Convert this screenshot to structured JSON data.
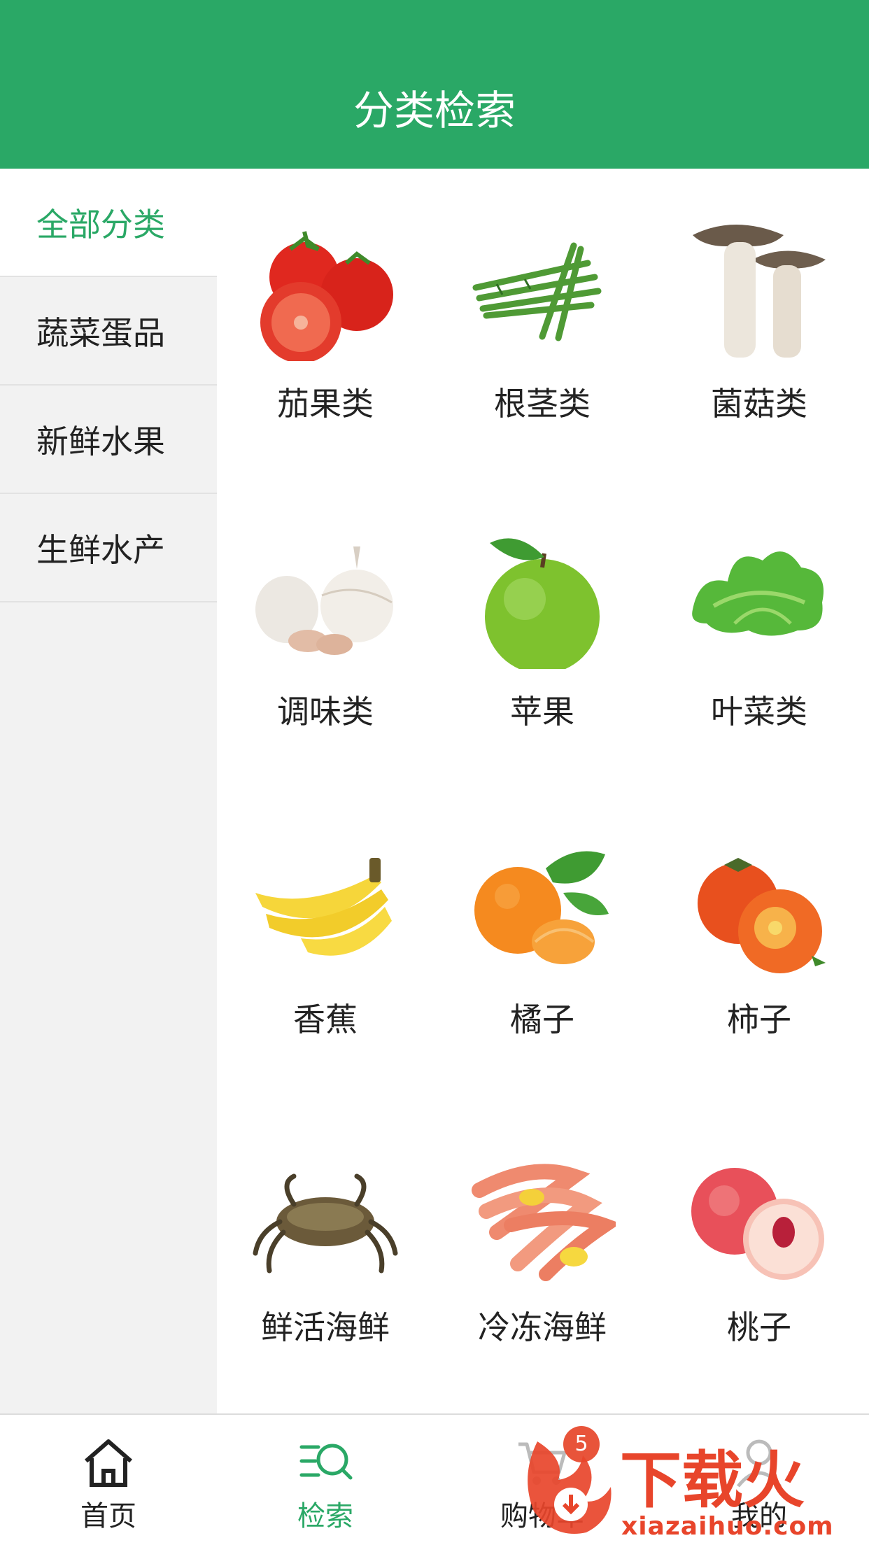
{
  "header": {
    "title": "分类检索"
  },
  "sidebar": {
    "items": [
      {
        "label": "全部分类",
        "active": true
      },
      {
        "label": "蔬菜蛋品",
        "active": false
      },
      {
        "label": "新鲜水果",
        "active": false
      },
      {
        "label": "生鲜水产",
        "active": false
      }
    ]
  },
  "grid": {
    "items": [
      {
        "label": "茄果类",
        "icon": "tomato-icon"
      },
      {
        "label": "根茎类",
        "icon": "asparagus-icon"
      },
      {
        "label": "菌菇类",
        "icon": "mushroom-icon"
      },
      {
        "label": "调味类",
        "icon": "garlic-icon"
      },
      {
        "label": "苹果",
        "icon": "apple-icon"
      },
      {
        "label": "叶菜类",
        "icon": "lettuce-icon"
      },
      {
        "label": "香蕉",
        "icon": "banana-icon"
      },
      {
        "label": "橘子",
        "icon": "orange-icon"
      },
      {
        "label": "柿子",
        "icon": "persimmon-icon"
      },
      {
        "label": "鲜活海鲜",
        "icon": "crab-icon"
      },
      {
        "label": "冷冻海鲜",
        "icon": "shrimp-icon"
      },
      {
        "label": "桃子",
        "icon": "peach-icon"
      }
    ]
  },
  "tabbar": {
    "tabs": [
      {
        "label": "首页",
        "icon": "home-icon"
      },
      {
        "label": "检索",
        "icon": "search-list-icon",
        "active": true
      },
      {
        "label": "购物车",
        "icon": "cart-icon",
        "badge": "5"
      },
      {
        "label": "我的",
        "icon": "user-icon"
      }
    ]
  },
  "watermark": {
    "title": "下载火",
    "url": "xiazaihuo.com"
  },
  "colors": {
    "brand": "#2aa866",
    "badge": "#e8543a",
    "watermark": "#e8452b"
  }
}
